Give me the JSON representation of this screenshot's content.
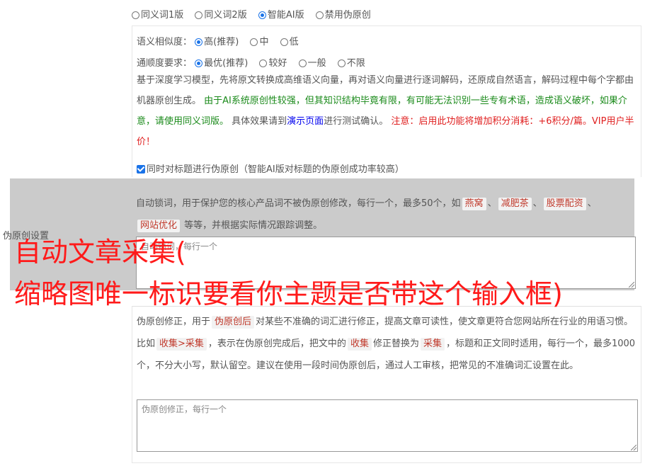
{
  "version_options": [
    {
      "label": "同义词1版",
      "selected": false
    },
    {
      "label": "同义词2版",
      "selected": false
    },
    {
      "label": "智能AI版",
      "selected": true
    },
    {
      "label": "禁用伪原创",
      "selected": false
    }
  ],
  "similarity": {
    "label": "语义相似度：",
    "options": [
      {
        "label": "高(推荐)",
        "selected": true
      },
      {
        "label": "中",
        "selected": false
      },
      {
        "label": "低",
        "selected": false
      }
    ]
  },
  "fluency": {
    "label": "通顺度要求：",
    "options": [
      {
        "label": "最优(推荐)",
        "selected": true
      },
      {
        "label": "较好",
        "selected": false
      },
      {
        "label": "一般",
        "selected": false
      },
      {
        "label": "不限",
        "selected": false
      }
    ]
  },
  "ai_description": {
    "intro": "基于深度学习模型，先将原文转换成高维语义向量，再对语义向量进行逐词解码，还原成自然语言，解码过程中每个字都由机器原创生成。",
    "warning_green": "由于AI系统原创性较强，但其知识结构毕竟有限，有可能无法识别一些专有术语，造成语义破坏，如果介意，请使用同义词版。",
    "effect_prefix": "具体效果请到",
    "demo_link": "演示页面",
    "effect_suffix": "进行测试确认。",
    "notice_red": "注意：启用此功能将增加积分消耗：+6积分/篇。VIP用户半价！"
  },
  "title_checkbox": {
    "label": "同时对标题进行伪原创（智能AI版对标题的伪原创成功率较高）",
    "checked": true
  },
  "side_label": "伪原创设置",
  "lock_words": {
    "desc_prefix": "自动锁词，用于保护您的核心产品词不被伪原创修改，每行一个，最多50个，如",
    "examples": [
      "燕窝",
      "减肥茶",
      "股票配资",
      "网站优化"
    ],
    "desc_suffix": "等等，并根据实际情况跟踪调整。",
    "placeholder": "自动锁词，每行一个"
  },
  "correction": {
    "desc_1": "伪原创修正，用于",
    "tag_1": "伪原创后",
    "desc_2": "对某些不准确的词汇进行修正，提高文章可读性，使文章更符合您网站所在行业的用语习惯。比如",
    "tag_2": "收集>采集",
    "desc_3": "，表示在伪原创完成后，把文中的",
    "tag_3": "收集",
    "desc_4": "修正替换为",
    "tag_4": "采集",
    "desc_5": "，标题和正文同时适用，每行一个，最多1000个，不分大小写，默认留空。建议在使用一段时间伪原创后，通过人工审核，把常见的不准确词汇设置在此。",
    "placeholder": "伪原创修正，每行一个"
  },
  "caption": {
    "line1": "自动文章采集(",
    "line2": "缩略图唯一标识要看你主题是否带这个输入框)"
  }
}
